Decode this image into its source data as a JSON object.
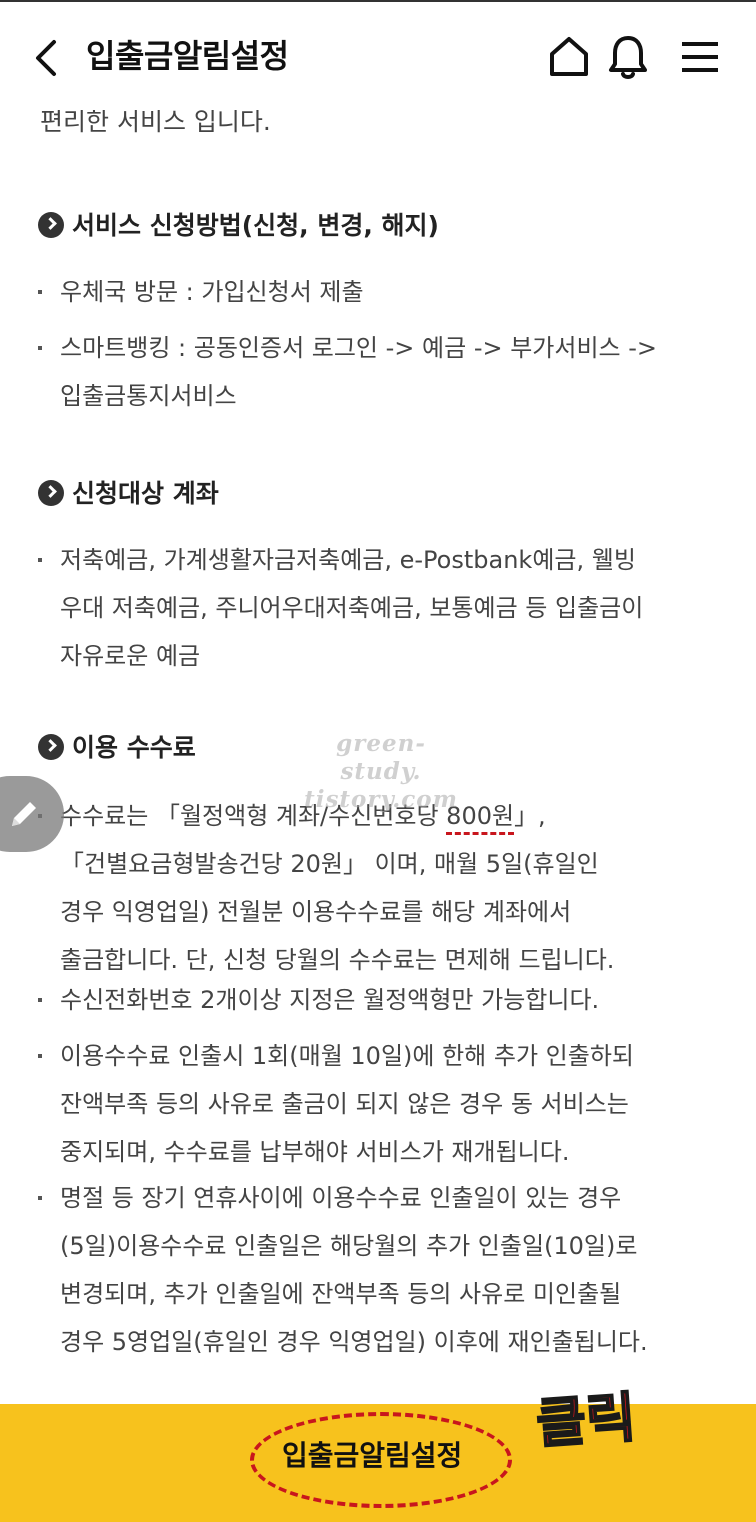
{
  "header": {
    "title": "입출금알림설정"
  },
  "content": {
    "intro": "편리한 서비스 입니다.",
    "sections": [
      {
        "title": "서비스 신청방법(신청, 변경, 해지)",
        "items": [
          [
            "우체국 방문 : 가입신청서 제출"
          ],
          [
            "스마트뱅킹 : 공동인증서 로그인 -> 예금 -> 부가서비스 ->",
            "입출금통지서비스"
          ]
        ]
      },
      {
        "title": "신청대상 계좌",
        "items": [
          [
            "저축예금, 가계생활자금저축예금, e-Postbank예금, 웰빙",
            "우대 저축예금, 주니어우대저축예금, 보통예금 등 입출금이",
            "자유로운 예금"
          ]
        ]
      },
      {
        "title": "이용 수수료",
        "fee_line1_prefix": "수수료는 「월정액형 계좌/수신번호당 ",
        "fee_highlight": "800원",
        "fee_line1_suffix": "」,",
        "items": [
          [
            "「건별요금형발송건당 20원」 이며, 매월 5일(휴일인",
            "경우 익영업일) 전월분 이용수수료를 해당 계좌에서",
            "출금합니다. 단, 신청 당월의 수수료는 면제해 드립니다."
          ],
          [
            "수신전화번호 2개이상 지정은 월정액형만 가능합니다."
          ],
          [
            "이용수수료 인출시 1회(매월 10일)에 한해 추가 인출하되",
            "잔액부족 등의 사유로 출금이 되지 않은 경우 동 서비스는",
            "중지되며, 수수료를 납부해야 서비스가 재개됩니다."
          ],
          [
            "명절 등 장기 연휴사이에 이용수수료 인출일이 있는 경우",
            "(5일)이용수수료 인출일은 해당월의 추가 인출일(10일)로",
            "변경되며, 추가 인출일에 잔액부족 등의 사유로 미인출될",
            "경우 5영업일(휴일인 경우 익영업일) 이후에 재인출됩니다."
          ]
        ]
      }
    ]
  },
  "watermark": {
    "line1": "green-study.",
    "line2": "tistory.com"
  },
  "bottom": {
    "button_label": "입출금알림설정",
    "annotation": "클릭"
  },
  "colors": {
    "accent_yellow": "#f7c21d",
    "annotation_red": "#c8161d"
  },
  "icons": [
    "back-arrow-icon",
    "home-icon",
    "bell-icon",
    "menu-icon",
    "pencil-icon",
    "chevron-circle-icon"
  ]
}
